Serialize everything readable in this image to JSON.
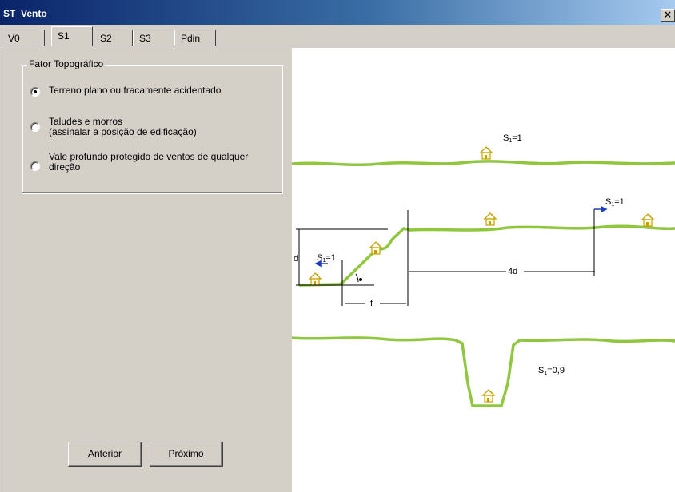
{
  "window": {
    "title": "ST_Vento",
    "close_glyph": "×"
  },
  "tabs": [
    {
      "label": "V0",
      "active": false
    },
    {
      "label": "S1",
      "active": true
    },
    {
      "label": "S2",
      "active": false
    },
    {
      "label": "S3",
      "active": false
    },
    {
      "label": "Pdin",
      "active": false
    }
  ],
  "group": {
    "title": "Fator Topográfico",
    "options": [
      {
        "line1": "Terreno plano ou fracamente acidentado",
        "line2": "",
        "checked": true
      },
      {
        "line1": "Taludes e morros",
        "line2": "(assinalar a posição de edificação)",
        "checked": false
      },
      {
        "line1": "Vale profundo protegido de ventos de qualquer",
        "line2": "direção",
        "checked": false
      }
    ]
  },
  "buttons": {
    "back_key": "A",
    "back_rest": "nterior",
    "next_key": "P",
    "next_rest": "róximo"
  },
  "diagram": {
    "top_label": {
      "s": "S",
      "sub": "1",
      "value": "=1"
    },
    "right_label": {
      "s": "S",
      "sub": "1",
      "value": "=1"
    },
    "slope_label": {
      "s": "S",
      "sub": "1",
      "value": "=1"
    },
    "valley_label": {
      "s": "S",
      "sub": "1",
      "value": "=0,9"
    },
    "dim_d": "d",
    "dim_4d": "4d",
    "dim_f": "f",
    "terrain_color": "#8fc73e",
    "arrow_color": "#1f3fbf",
    "house_color": "#c8a000",
    "icons": [
      "house-icon",
      "wind-arrow-icon",
      "angle-theta-icon"
    ]
  }
}
